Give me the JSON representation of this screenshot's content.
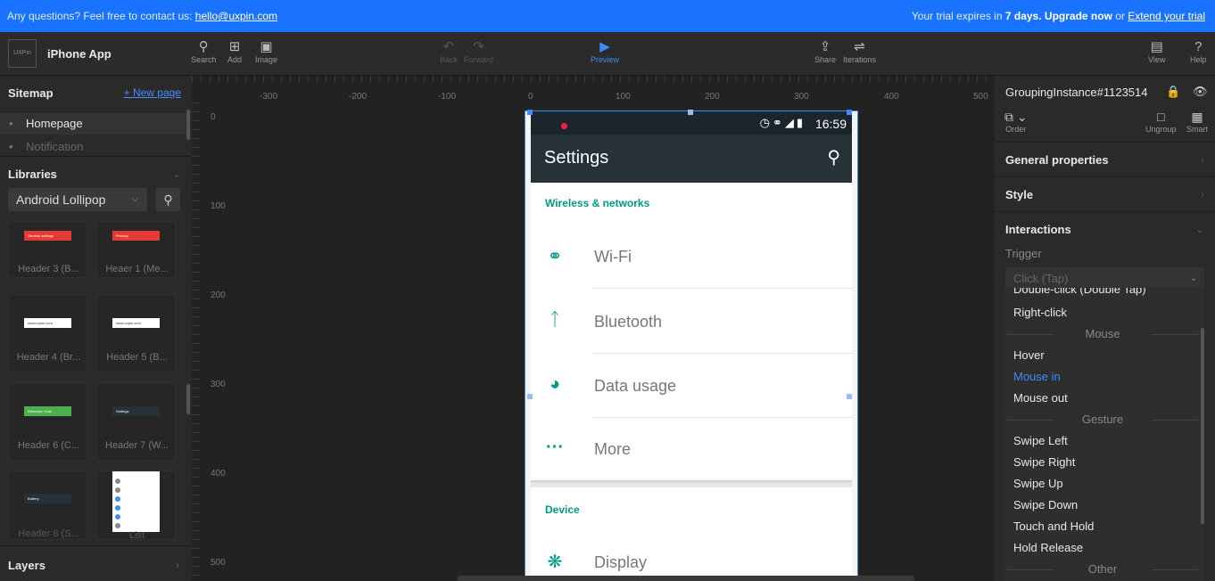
{
  "banner": {
    "question": "Any questions? Feel free to contact us:",
    "email": "hello@uxpin.com",
    "trial_prefix": "Your trial expires in",
    "trial_days": "7 days.",
    "upgrade": "Upgrade now",
    "or": "or",
    "extend": "Extend your trial"
  },
  "toolbar": {
    "logo": "UXPin",
    "app_title": "iPhone App",
    "search": "Search",
    "add": "Add",
    "image": "Image",
    "back": "Back",
    "forward": "Forward",
    "preview": "Preview",
    "share": "Share",
    "iterations": "Iterations",
    "view": "View",
    "help": "Help"
  },
  "sitemap": {
    "title": "Sitemap",
    "new_page": "+ New page",
    "items": [
      "Homepage",
      "Notification"
    ]
  },
  "libraries": {
    "title": "Libraries",
    "selected": "Android Lollipop",
    "tiles": [
      {
        "name": "Header 3 (B...",
        "thumb": "General settings",
        "color": "#e53935"
      },
      {
        "name": "Heaer 1 (Me...",
        "thumb": "Primary",
        "color": "#e53935"
      },
      {
        "name": "Header 4 (Br...",
        "thumb": "www.uxpin.com",
        "color": "#ffffff"
      },
      {
        "name": "Header 5 (B...",
        "thumb": "www.uxpin.com",
        "color": "#ffffff"
      },
      {
        "name": "Header 6 (C...",
        "thumb": "Refresher Dutil",
        "color": "#4caf50"
      },
      {
        "name": "Header 7 (W...",
        "thumb": "Settings",
        "color": "#263238"
      },
      {
        "name": "Header 8 (S...",
        "thumb": "Battery",
        "color": "#263238"
      },
      {
        "name": "List",
        "thumb": "",
        "color": "#ffffff"
      }
    ]
  },
  "layers": {
    "title": "Layers"
  },
  "ruler": {
    "h_ticks": [
      "-300",
      "-200",
      "-100",
      "0",
      "100",
      "200",
      "300",
      "400",
      "500"
    ],
    "v_ticks": [
      "0",
      "100",
      "200",
      "300",
      "400",
      "500"
    ]
  },
  "phone": {
    "time": "16:59",
    "app_title": "Settings",
    "section1": "Wireless & networks",
    "rows1": [
      {
        "label": "Wi-Fi",
        "icon": "wifi-icon"
      },
      {
        "label": "Bluetooth",
        "icon": "bluetooth-icon"
      },
      {
        "label": "Data usage",
        "icon": "data-usage-icon"
      },
      {
        "label": "More",
        "icon": "more-icon"
      }
    ],
    "section2": "Device",
    "rows2": [
      {
        "label": "Display",
        "icon": "display-icon"
      }
    ],
    "accent": "#009688",
    "bar_color": "#263238"
  },
  "properties": {
    "element_name": "GroupingInstance#1123514",
    "order": "Order",
    "ungroup": "Ungroup",
    "smart": "Smart",
    "general": "General properties",
    "style": "Style",
    "interactions": "Interactions",
    "trigger_label": "Trigger",
    "trigger_value": "Click (Tap)",
    "dropdown": {
      "partial_top": "Double-click (Double Tap)",
      "right_click": "Right-click",
      "group_mouse": "Mouse",
      "hover": "Hover",
      "mouse_in": "Mouse in",
      "mouse_out": "Mouse out",
      "group_gesture": "Gesture",
      "swipe_left": "Swipe Left",
      "swipe_right": "Swipe Right",
      "swipe_up": "Swipe Up",
      "swipe_down": "Swipe Down",
      "touch_hold": "Touch and Hold",
      "hold_release": "Hold Release",
      "group_other": "Other"
    }
  }
}
